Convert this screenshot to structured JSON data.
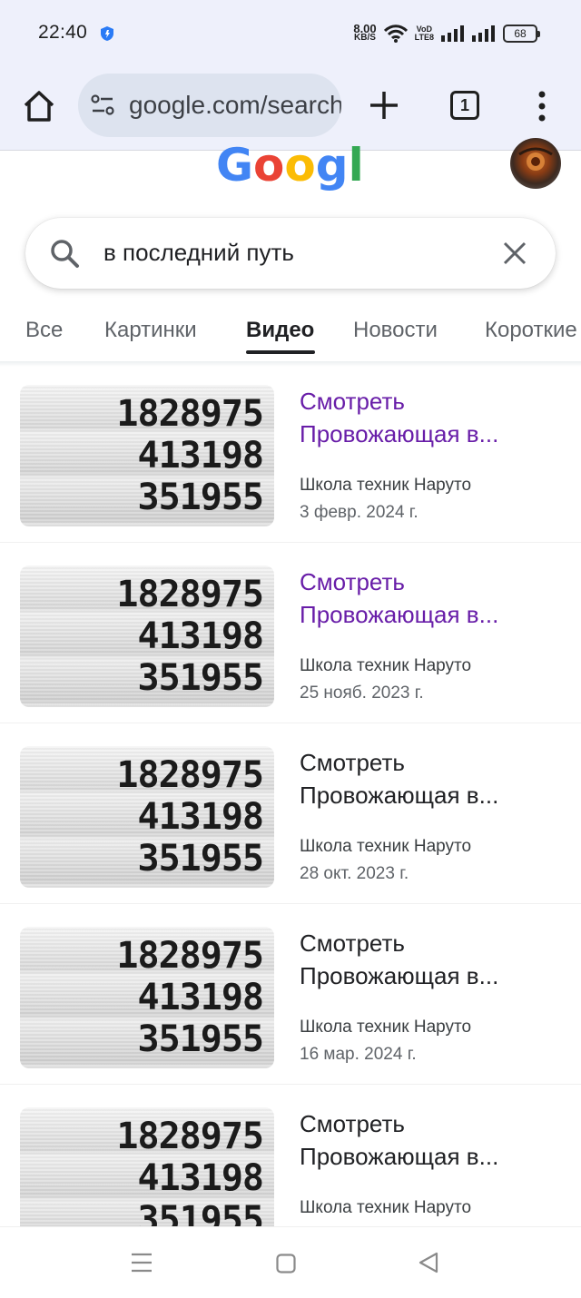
{
  "status_bar": {
    "time": "22:40",
    "net_speed_value": "8.00",
    "net_speed_unit": "KB/S",
    "volte_top": "VoD",
    "volte_bottom": "LTE8",
    "battery": "68"
  },
  "browser": {
    "url": "google.com/search",
    "tab_count": "1"
  },
  "search": {
    "query": "в последний путь"
  },
  "tabs": [
    {
      "label": "Все",
      "active": false
    },
    {
      "label": "Картинки",
      "active": false
    },
    {
      "label": "Видео",
      "active": true
    },
    {
      "label": "Новости",
      "active": false
    },
    {
      "label": "Короткие",
      "active": false
    }
  ],
  "results": [
    {
      "title_line1": "Смотреть",
      "title_line2": "Провожающая в...",
      "source": "Школа техник Наруто",
      "date": "3 февр. 2024 г.",
      "visited": true,
      "thumb_numbers": [
        "1828975",
        "413198",
        "351955"
      ]
    },
    {
      "title_line1": "Смотреть",
      "title_line2": "Провожающая в...",
      "source": "Школа техник Наруто",
      "date": "25 нояб. 2023 г.",
      "visited": true,
      "thumb_numbers": [
        "1828975",
        "413198",
        "351955"
      ]
    },
    {
      "title_line1": "Смотреть",
      "title_line2": "Провожающая в...",
      "source": "Школа техник Наруто",
      "date": "28 окт. 2023 г.",
      "visited": false,
      "thumb_numbers": [
        "1828975",
        "413198",
        "351955"
      ]
    },
    {
      "title_line1": "Смотреть",
      "title_line2": "Провожающая в...",
      "source": "Школа техник Наруто",
      "date": "16 мар. 2024 г.",
      "visited": false,
      "thumb_numbers": [
        "1828975",
        "413198",
        "351955"
      ]
    },
    {
      "title_line1": "Смотреть",
      "title_line2": "Провожающая в...",
      "source": "Школа техник Наруто",
      "date": "",
      "visited": false,
      "thumb_numbers": [
        "1828975",
        "413198",
        "351955"
      ]
    }
  ],
  "colors": {
    "visited_link": "#681da8",
    "toolbar_bg": "#eef0fb",
    "omnibox_bg": "#dde3ef"
  }
}
